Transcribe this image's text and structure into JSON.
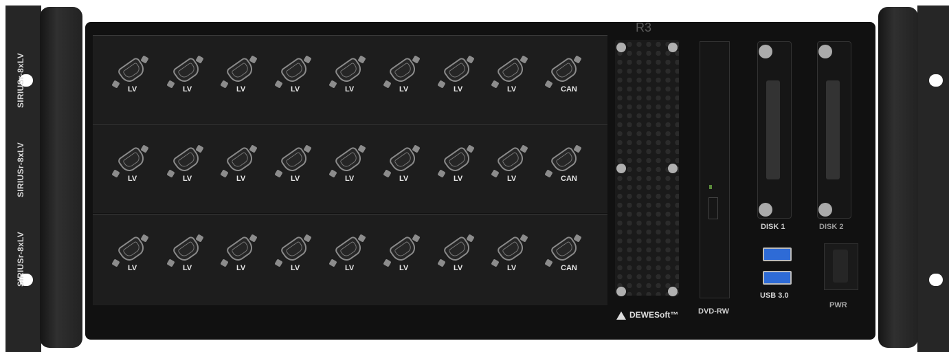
{
  "side_labels": [
    "SIRIUSr-8xLV",
    "SIRIUSr-8xLV",
    "SIRIUSr-8xLV"
  ],
  "slot_title": "R3",
  "rows": [
    [
      "LV",
      "LV",
      "LV",
      "LV",
      "LV",
      "LV",
      "LV",
      "LV",
      "CAN"
    ],
    [
      "LV",
      "LV",
      "LV",
      "LV",
      "LV",
      "LV",
      "LV",
      "LV",
      "CAN"
    ],
    [
      "LV",
      "LV",
      "LV",
      "LV",
      "LV",
      "LV",
      "LV",
      "LV",
      "CAN"
    ]
  ],
  "disk1_label": "DISK 1",
  "disk2_label": "DISK 2",
  "usb_label": "USB 3.0",
  "pwr_label": "PWR",
  "dvd_label": "DVD-RW",
  "brand": "DEWESoft™"
}
